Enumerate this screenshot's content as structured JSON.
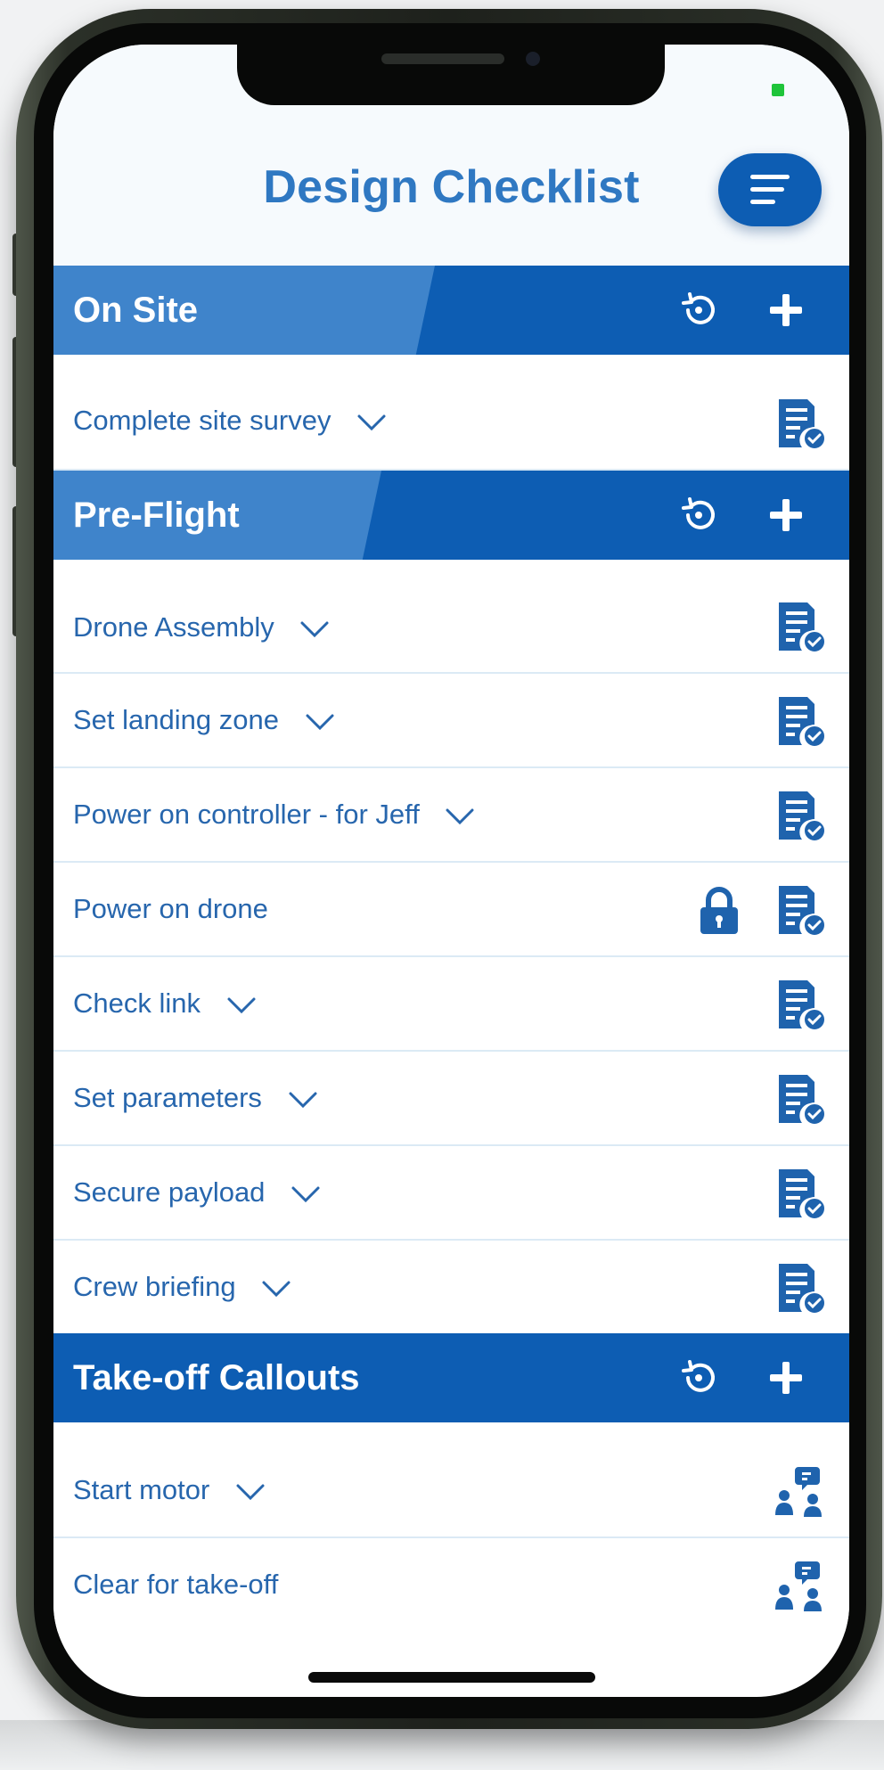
{
  "app": {
    "title": "Design Checklist",
    "menu_icon": "hamburger-menu-icon"
  },
  "colors": {
    "primary": "#0d5db3",
    "stripe": "#3f84cb",
    "title": "#2f78c2",
    "text": "#2766ad"
  },
  "sections": [
    {
      "title": "On Site",
      "items": [
        {
          "label": "Complete site survey",
          "expand": true,
          "icon": "checklist-icon"
        }
      ]
    },
    {
      "title": "Pre-Flight",
      "items": [
        {
          "label": "Drone Assembly",
          "expand": true,
          "icon": "checklist-icon"
        },
        {
          "label": "Set landing zone",
          "expand": true,
          "icon": "checklist-icon"
        },
        {
          "label": "Power on controller - for Jeff",
          "expand": true,
          "icon": "checklist-icon"
        },
        {
          "label": "Power on drone",
          "expand": false,
          "locked": true,
          "icon": "checklist-icon"
        },
        {
          "label": "Check link",
          "expand": true,
          "icon": "checklist-icon"
        },
        {
          "label": "Set parameters",
          "expand": true,
          "icon": "checklist-icon"
        },
        {
          "label": "Secure payload",
          "expand": true,
          "icon": "checklist-icon"
        },
        {
          "label": "Crew briefing",
          "expand": true,
          "icon": "checklist-icon"
        }
      ]
    },
    {
      "title": "Take-off Callouts",
      "items": [
        {
          "label": "Start motor",
          "expand": true,
          "icon": "crew-callout-icon"
        },
        {
          "label": "Clear for take-off",
          "expand": false,
          "icon": "crew-callout-icon"
        }
      ]
    }
  ]
}
